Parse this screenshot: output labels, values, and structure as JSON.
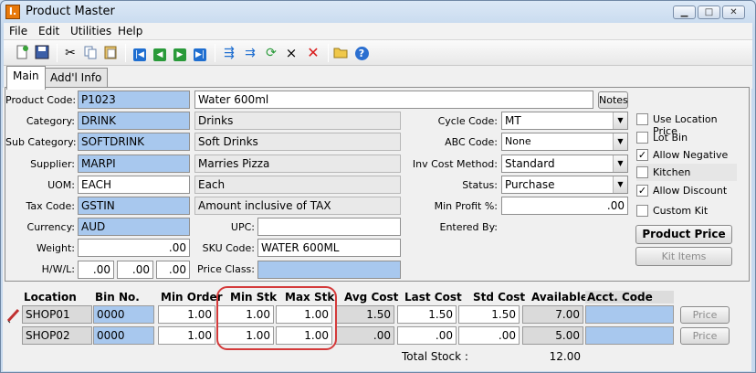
{
  "window": {
    "title": "Product Master",
    "app_icon_letter": "I."
  },
  "menu": [
    "File",
    "Edit",
    "Utilities",
    "Help"
  ],
  "toolbar": {
    "icons": [
      "new-icon",
      "save-icon",
      "cut-icon",
      "copy-icon",
      "paste-icon",
      "first-icon",
      "prev-icon",
      "next-icon",
      "last-icon",
      "indent-icon",
      "outdent-icon",
      "refresh-icon",
      "small-delete-icon",
      "delete-icon",
      "open-folder-icon",
      "help-icon"
    ],
    "small_x": "×",
    "big_x": "✕",
    "help": "?"
  },
  "tabs": [
    "Main",
    "Add'l Info"
  ],
  "form": {
    "product_code": {
      "label": "Product Code:",
      "value": "P1023",
      "desc": "Water 600ml"
    },
    "notes_button": "Notes",
    "category": {
      "label": "Category:",
      "value": "DRINK",
      "desc": "Drinks"
    },
    "sub_category": {
      "label": "Sub Category:",
      "value": "SOFTDRINK",
      "desc": "Soft Drinks"
    },
    "supplier": {
      "label": "Supplier:",
      "value": "MARPI",
      "desc": "Marries Pizza"
    },
    "uom": {
      "label": "UOM:",
      "value": "EACH",
      "desc": "Each"
    },
    "tax_code": {
      "label": "Tax Code:",
      "value": "GSTIN",
      "desc": "Amount inclusive of TAX"
    },
    "currency": {
      "label": "Currency:",
      "value": "AUD"
    },
    "upc": {
      "label": "UPC:",
      "value": ""
    },
    "weight": {
      "label": "Weight:",
      "value": ".00"
    },
    "sku_code": {
      "label": "SKU Code:",
      "value": "WATER 600ML"
    },
    "hwl": {
      "label": "H/W/L:",
      "h": ".00",
      "w": ".00",
      "l": ".00"
    },
    "price_class": {
      "label": "Price Class:",
      "value": ""
    },
    "cycle_code": {
      "label": "Cycle Code:",
      "value": "MT"
    },
    "abc_code": {
      "label": "ABC Code:",
      "value": "None"
    },
    "inv_cost_method": {
      "label": "Inv Cost Method:",
      "value": "Standard"
    },
    "status": {
      "label": "Status:",
      "value": "Purchase"
    },
    "min_profit": {
      "label": "Min Profit %:",
      "value": ".00"
    },
    "entered_by": {
      "label": "Entered By:",
      "value": ""
    }
  },
  "checkboxes": [
    {
      "label": "Use Location Price",
      "checked": false
    },
    {
      "label": "Lot Bin",
      "checked": false
    },
    {
      "label": "Allow Negative",
      "checked": true
    },
    {
      "label": "Kitchen",
      "checked": false
    },
    {
      "label": "Allow Discount",
      "checked": true
    },
    {
      "label": "Custom Kit",
      "checked": false
    }
  ],
  "check_mark": "✓",
  "buttons": {
    "product_price": "Product Price",
    "kit_items": "Kit Items",
    "price": "Price"
  },
  "grid": {
    "headers": [
      "Location",
      "Bin No.",
      "Min Order",
      "Min Stk",
      "Max Stk",
      "Avg Cost",
      "Last Cost",
      "Std Cost",
      "Available",
      "Acct. Code"
    ],
    "rows": [
      {
        "location": "SHOP01",
        "bin": "0000",
        "min_order": "1.00",
        "min_stk": "1.00",
        "max_stk": "1.00",
        "avg_cost": "1.50",
        "last_cost": "1.50",
        "std_cost": "1.50",
        "available": "7.00",
        "acct_code": ""
      },
      {
        "location": "SHOP02",
        "bin": "0000",
        "min_order": "1.00",
        "min_stk": "1.00",
        "max_stk": "1.00",
        "avg_cost": ".00",
        "last_cost": ".00",
        "std_cost": ".00",
        "available": "5.00",
        "acct_code": ""
      }
    ],
    "total_stock_label": "Total Stock :",
    "total_stock_value": "12.00"
  },
  "colors": {
    "accent_blue": "#a8c8ee",
    "highlight_red": "#d43a3a"
  }
}
